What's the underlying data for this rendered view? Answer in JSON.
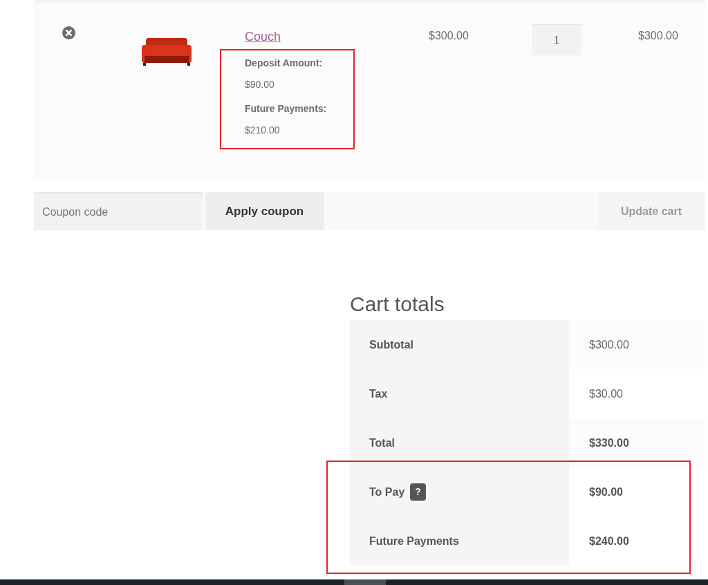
{
  "cart_item": {
    "name": "Couch",
    "meta": [
      {
        "label": "Deposit Amount:",
        "value": "$90.00"
      },
      {
        "label": "Future Payments:",
        "value": "$210.00"
      }
    ],
    "meta_highlighted": true,
    "price": "$300.00",
    "quantity": "1",
    "subtotal": "$300.00"
  },
  "coupon": {
    "placeholder": "Coupon code",
    "apply_button": "Apply coupon",
    "update_button": "Update cart",
    "update_disabled": true
  },
  "cart_totals": {
    "title": "Cart totals",
    "rows": [
      {
        "label": "Subtotal",
        "value": "$300.00",
        "strong": false
      },
      {
        "label": "Tax",
        "value": "$30.00",
        "strong": false
      },
      {
        "label": "Total",
        "value": "$330.00",
        "strong": true
      }
    ],
    "highlighted_rows": [
      {
        "label": "To Pay",
        "help": "?",
        "value": "$90.00",
        "strong": true
      },
      {
        "label": "Future Payments",
        "value": "$240.00",
        "strong": true
      }
    ]
  }
}
